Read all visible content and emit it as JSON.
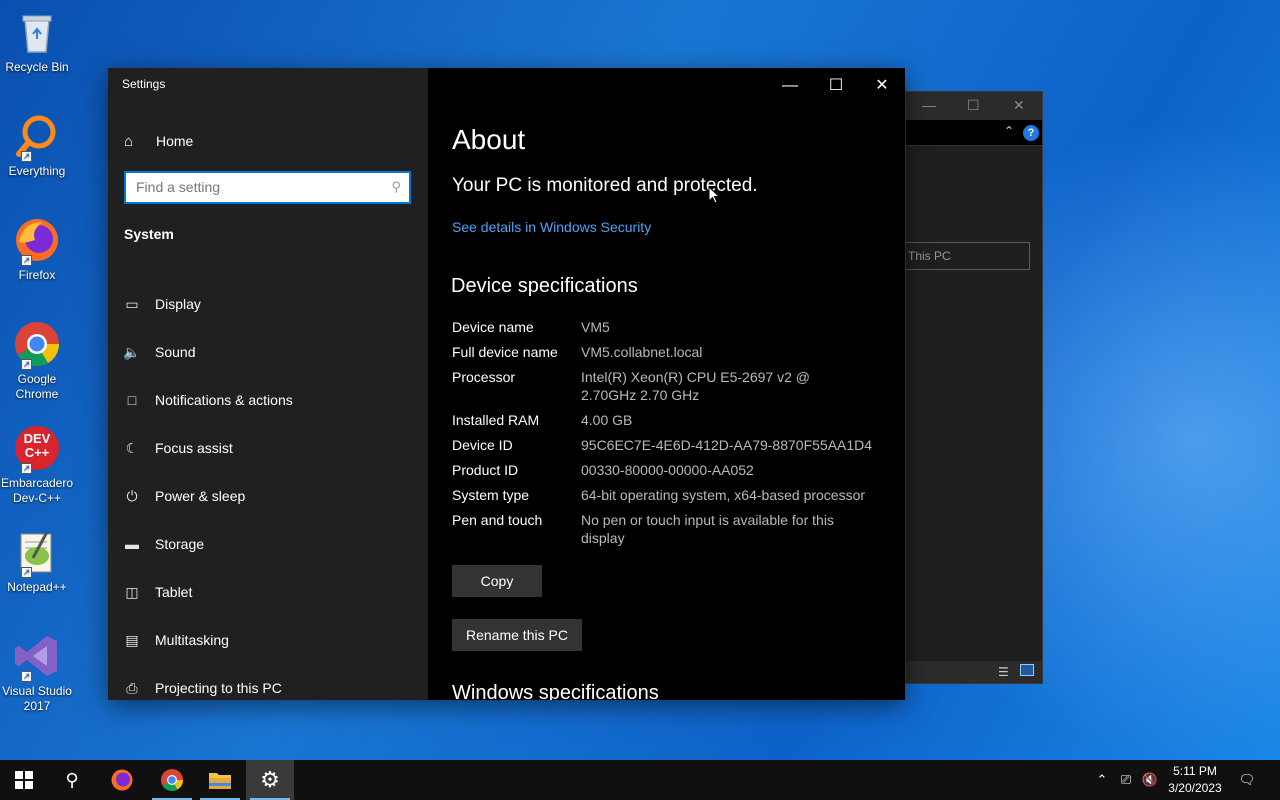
{
  "desktop": {
    "icons": [
      {
        "label": "Recycle Bin",
        "icon": "recycle-bin-icon"
      },
      {
        "label": "Everything",
        "icon": "magnifier-icon"
      },
      {
        "label": "Firefox",
        "icon": "firefox-icon"
      },
      {
        "label": "Google Chrome",
        "icon": "chrome-icon"
      },
      {
        "label": "Embarcadero Dev-C++",
        "icon": "devcpp-icon",
        "badge": "DEV C++"
      },
      {
        "label": "Notepad++",
        "icon": "notepadpp-icon"
      },
      {
        "label": "Visual Studio 2017",
        "icon": "visual-studio-icon"
      }
    ]
  },
  "explorer": {
    "address": "This PC",
    "help": "?"
  },
  "settings": {
    "window_title": "Settings",
    "nav": {
      "home_label": "Home",
      "search_placeholder": "Find a setting",
      "section_label": "System",
      "items": [
        {
          "label": "Display",
          "icon": "monitor-icon"
        },
        {
          "label": "Sound",
          "icon": "speaker-icon"
        },
        {
          "label": "Notifications & actions",
          "icon": "notification-icon"
        },
        {
          "label": "Focus assist",
          "icon": "moon-icon"
        },
        {
          "label": "Power & sleep",
          "icon": "power-icon"
        },
        {
          "label": "Storage",
          "icon": "storage-icon"
        },
        {
          "label": "Tablet",
          "icon": "tablet-icon"
        },
        {
          "label": "Multitasking",
          "icon": "multitasking-icon"
        },
        {
          "label": "Projecting to this PC",
          "icon": "projecting-icon"
        }
      ]
    },
    "content": {
      "heading": "About",
      "protection_status": "Your PC is monitored and protected.",
      "security_link": "See details in Windows Security",
      "device_spec_heading": "Device specifications",
      "specs": [
        {
          "key": "Device name",
          "value": "VM5"
        },
        {
          "key": "Full device name",
          "value": "VM5.collabnet.local"
        },
        {
          "key": "Processor",
          "value": "Intel(R) Xeon(R) CPU E5-2697 v2 @ 2.70GHz 2.70 GHz"
        },
        {
          "key": "Installed RAM",
          "value": "4.00 GB"
        },
        {
          "key": "Device ID",
          "value": "95C6EC7E-4E6D-412D-AA79-8870F55AA1D4"
        },
        {
          "key": "Product ID",
          "value": "00330-80000-00000-AA052"
        },
        {
          "key": "System type",
          "value": "64-bit operating system, x64-based processor"
        },
        {
          "key": "Pen and touch",
          "value": "No pen or touch input is available for this display"
        }
      ],
      "copy_button": "Copy",
      "rename_button": "Rename this PC",
      "windows_spec_heading": "Windows specifications"
    }
  },
  "taskbar": {
    "time": "5:11 PM",
    "date": "3/20/2023"
  }
}
